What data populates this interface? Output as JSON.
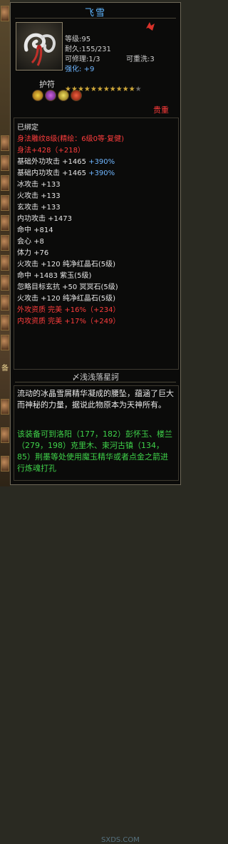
{
  "item": {
    "name": "飞雪",
    "level": "等级:95",
    "durability": "耐久:155/231",
    "repairable": "可修理:1/3",
    "rewashable": "可重洗:3",
    "enhance_label": "强化:",
    "enhance_value": "+9"
  },
  "charm": {
    "label": "护符",
    "stars_filled": 11,
    "stars_total": 12,
    "rank": "贵重"
  },
  "attributes": [
    {
      "text": "已绑定",
      "color": "white"
    },
    {
      "text": "身法雕纹8级(精绘：6级0等·复健)",
      "color": "red"
    },
    {
      "text": "身法+428（+218）",
      "color": "red"
    },
    {
      "text": "基础外功攻击 +1465 +390%",
      "color": "white",
      "accent": "+390%"
    },
    {
      "text": "基础内功攻击 +1465 +390%",
      "color": "white",
      "accent": "+390%"
    },
    {
      "text": "冰攻击 +133",
      "color": "white"
    },
    {
      "text": "火攻击 +133",
      "color": "white"
    },
    {
      "text": "玄攻击 +133",
      "color": "white"
    },
    {
      "text": "内功攻击 +1473",
      "color": "white"
    },
    {
      "text": "命中 +814",
      "color": "white"
    },
    {
      "text": "会心 +8",
      "color": "white"
    },
    {
      "text": "体力 +76",
      "color": "white"
    },
    {
      "text": "火攻击 +120 纯净红晶石(5级)",
      "color": "white"
    },
    {
      "text": "命中 +1483 紫玉(5级)",
      "color": "white"
    },
    {
      "text": "忽略目标玄抗 +50 冥冥石(5级)",
      "color": "white"
    },
    {
      "text": "火攻击 +120 纯净红晶石(5级)",
      "color": "white"
    },
    {
      "text": "外攻资质   完美 +16%（+234）",
      "color": "red"
    },
    {
      "text": "内攻资质   完美 +17%（+249）",
      "color": "red"
    }
  ],
  "set_title": "〆浅浅落星訶",
  "description": "流动的冰晶雪屑精华凝成的腰坠，蕴涵了巨大而神秘的力量，据说此物原本为天神所有。",
  "task_text": "该装备可到洛阳（177，182）彭怀玉、楼兰（279，198）克里木、束河古镇（134，85）荆墨等处使用魔玉精华或者点金之箭进行炼魂打孔",
  "watermark": "SXDS.COM",
  "left_strip_label": "备",
  "colors": {
    "title": "#5fb6ff",
    "red": "#ff3d3d",
    "blue": "#6fb6ff",
    "green": "#3fd24a",
    "white": "#e6e6e6"
  }
}
